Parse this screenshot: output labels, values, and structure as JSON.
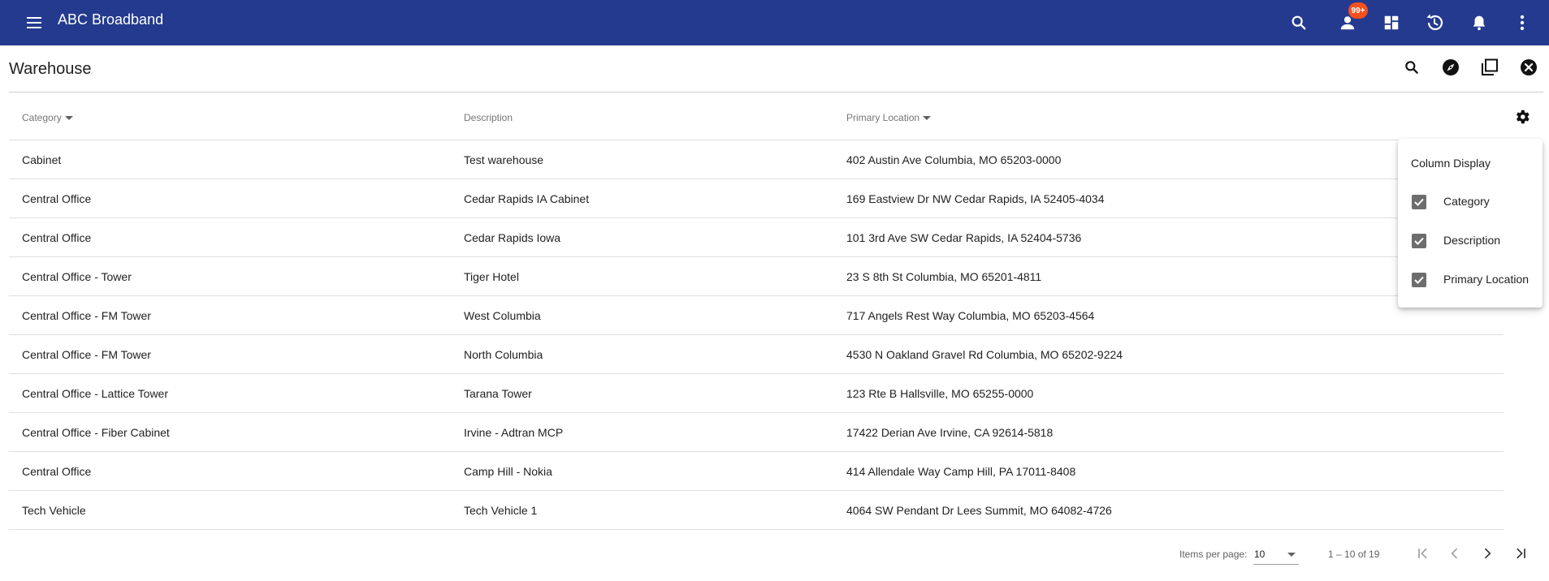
{
  "app": {
    "title": "ABC Broadband",
    "notification_badge": "99+",
    "brand_color": "#233a8e",
    "badge_color": "#f4511e",
    "icons": {
      "menu": "menu-icon",
      "search": "search-icon",
      "user": "user-icon",
      "dashboard": "dashboard-icon",
      "history": "history-icon",
      "notifications": "bell-icon",
      "more": "more-vert-icon"
    }
  },
  "page": {
    "title": "Warehouse",
    "icons": [
      "search-icon",
      "compass-icon",
      "copy-icon",
      "close-icon"
    ]
  },
  "table": {
    "headers": {
      "category": "Category",
      "description": "Description",
      "primary_location": "Primary Location"
    },
    "rows": [
      {
        "category": "Cabinet",
        "description": "Test warehouse",
        "primary_location": "402 Austin Ave Columbia, MO 65203-0000"
      },
      {
        "category": "Central Office",
        "description": "Cedar Rapids IA Cabinet",
        "primary_location": "169 Eastview Dr NW Cedar Rapids, IA 52405-4034"
      },
      {
        "category": "Central Office",
        "description": "Cedar Rapids Iowa",
        "primary_location": "101 3rd Ave SW Cedar Rapids, IA 52404-5736"
      },
      {
        "category": "Central Office - Tower",
        "description": "Tiger Hotel",
        "primary_location": "23 S 8th St Columbia, MO 65201-4811"
      },
      {
        "category": "Central Office - FM Tower",
        "description": "West Columbia",
        "primary_location": "717 Angels Rest Way Columbia, MO 65203-4564"
      },
      {
        "category": "Central Office - FM Tower",
        "description": "North Columbia",
        "primary_location": "4530 N Oakland Gravel Rd Columbia, MO 65202-9224"
      },
      {
        "category": "Central Office - Lattice Tower",
        "description": "Tarana Tower",
        "primary_location": "123 Rte B Hallsville, MO 65255-0000"
      },
      {
        "category": "Central Office - Fiber Cabinet",
        "description": "Irvine - Adtran MCP",
        "primary_location": "17422 Derian Ave Irvine, CA 92614-5818"
      },
      {
        "category": "Central Office",
        "description": "Camp Hill - Nokia",
        "primary_location": "414 Allendale Way Camp Hill, PA 17011-8408"
      },
      {
        "category": "Tech Vehicle",
        "description": "Tech Vehicle 1",
        "primary_location": "4064 SW Pendant Dr Lees Summit, MO 64082-4726"
      }
    ]
  },
  "column_display": {
    "title": "Column Display",
    "options": [
      {
        "label": "Category",
        "checked": true
      },
      {
        "label": "Description",
        "checked": true
      },
      {
        "label": "Primary Location",
        "checked": true
      }
    ]
  },
  "paginator": {
    "items_per_page_label": "Items per page:",
    "items_per_page": "10",
    "range_label": "1 – 10 of 19"
  }
}
